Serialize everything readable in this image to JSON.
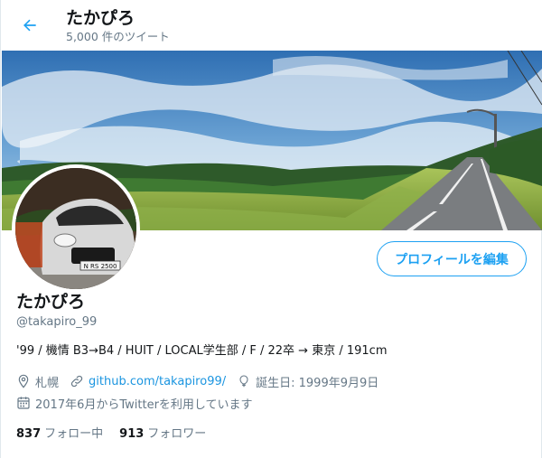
{
  "header": {
    "title": "たかぴろ",
    "subtitle": "5,000 件のツイート"
  },
  "profile": {
    "name": "たかぴろ",
    "handle": "@takapiro_99",
    "bio": "'99 / 機情 B3→B4 / HUIT / LOCAL学生部 / F / 22卒 → 東京 / 191cm",
    "location": "札幌",
    "website": "github.com/takapiro99/",
    "birthday": "誕生日: 1999年9月9日",
    "joined": "2017年6月からTwitterを利用しています",
    "avatar_plate_text": "N RS 2500"
  },
  "actions": {
    "edit_profile": "プロフィールを編集"
  },
  "stats": {
    "following_count": "837",
    "following_label": "フォロー中",
    "followers_count": "913",
    "followers_label": "フォロワー"
  },
  "icons": [
    "back-arrow-icon",
    "location-pin-icon",
    "link-icon",
    "balloon-icon",
    "calendar-icon"
  ],
  "colors": {
    "accent": "#1da1f2",
    "link": "#1b95e0",
    "secondary_text": "#657786",
    "primary_text": "#14171a"
  }
}
